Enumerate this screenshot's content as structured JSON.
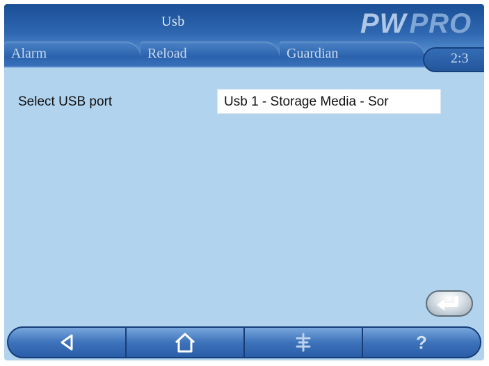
{
  "header": {
    "title": "Usb",
    "logo_main": "PW",
    "logo_sub": "PRO",
    "tabs": [
      {
        "label": "Alarm"
      },
      {
        "label": "Reload"
      },
      {
        "label": "Guardian"
      }
    ],
    "clock": "2:3"
  },
  "content": {
    "usb_port_label": "Select USB port",
    "usb_port_selected": "Usb 1 - Storage Media - Sor"
  },
  "nav": {
    "items": [
      {
        "icon": "back-triangle-icon"
      },
      {
        "icon": "home-icon"
      },
      {
        "icon": "settings-icon"
      },
      {
        "icon": "help-icon",
        "label": "?"
      }
    ]
  },
  "colors": {
    "background": "#b2d3ee",
    "header_dark": "#1b4f96",
    "nav_blue": "#3d73bb"
  }
}
